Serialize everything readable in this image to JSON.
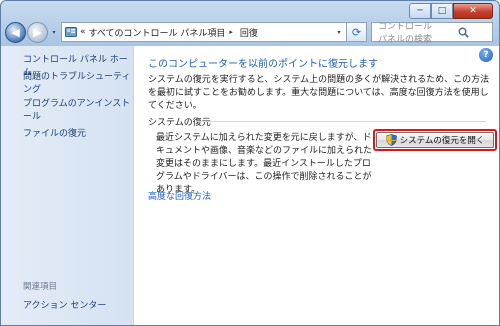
{
  "window": {
    "minimize_label": "─",
    "maximize_label": "□",
    "close_label": "✕"
  },
  "address": {
    "chevron": "«",
    "crumbs": [
      "すべてのコントロール パネル項目",
      "回復"
    ],
    "separator": "▸",
    "dropdown_glyph": "▾",
    "refresh_glyph": "⟳",
    "search_placeholder": "コントロール パネルの検索"
  },
  "nav": {
    "back_glyph": "◀",
    "forward_glyph": "▶",
    "history_glyph": "▾"
  },
  "sidebar": {
    "home": "コントロール パネル ホーム",
    "links": [
      "問題のトラブルシューティング",
      "プログラムのアンインストール",
      "ファイルの復元"
    ],
    "related_header": "関連項目",
    "related_link": "アクション センター"
  },
  "main": {
    "help": "?",
    "title": "このコンピューターを以前のポイントに復元します",
    "description": "システムの復元を実行すると、システム上の問題の多くが解決されるため、この方法を最初に試すことをお勧めします。重大な問題については、高度な回復方法を使用してください。",
    "group_header": "システムの復元",
    "group_description": "最近システムに加えられた変更を元に戻しますが、ドキュメントや画像、音楽などのファイルに加えられた変更はそのままにします。最近インストールしたプログラムやドライバーは、この操作で削除されることがあります。",
    "restore_button": "システムの復元を開く",
    "advanced_link": "高度な回復方法"
  },
  "colors": {
    "link": "#1e5ebf",
    "highlight_border": "#e11515",
    "sidebar_link": "#1a3f74"
  }
}
